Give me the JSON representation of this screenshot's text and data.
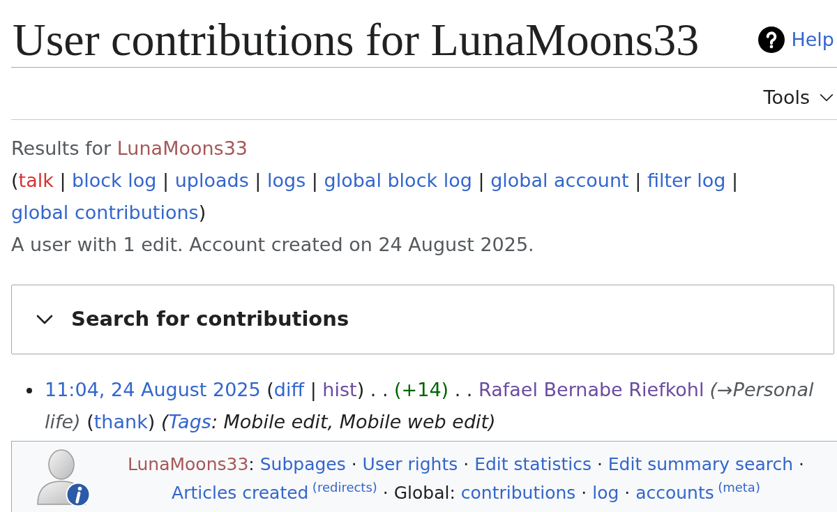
{
  "header": {
    "title": "User contributions for LunaMoons33",
    "help": "Help"
  },
  "tools": {
    "label": "Tools"
  },
  "results": [
    {
      "kind": "plain",
      "text": "Results for "
    },
    {
      "kind": "new-visited",
      "text": "LunaMoons33"
    }
  ],
  "user_links": [
    {
      "kind": "plain",
      "text": "("
    },
    {
      "kind": "new",
      "text": "talk"
    },
    {
      "kind": "plain",
      "text": " | "
    },
    {
      "kind": "link",
      "text": "block log"
    },
    {
      "kind": "plain",
      "text": " | "
    },
    {
      "kind": "link",
      "text": "uploads"
    },
    {
      "kind": "plain",
      "text": " | "
    },
    {
      "kind": "link",
      "text": "logs"
    },
    {
      "kind": "plain",
      "text": " | "
    },
    {
      "kind": "link",
      "text": "global block log"
    },
    {
      "kind": "plain",
      "text": " | "
    },
    {
      "kind": "link",
      "text": "global account"
    },
    {
      "kind": "plain",
      "text": " | "
    },
    {
      "kind": "link",
      "text": "filter log"
    },
    {
      "kind": "plain",
      "text": " | "
    },
    {
      "kind": "link",
      "text": "global contributions"
    },
    {
      "kind": "plain",
      "text": ")"
    }
  ],
  "summary": "A user with 1 edit. Account created on 24 August 2025.",
  "search_panel": {
    "title": "Search for contributions",
    "expanded": false
  },
  "contributions": [
    {
      "segments": [
        {
          "kind": "link",
          "text": "11:04, 24 August 2025"
        },
        {
          "kind": "plain",
          "text": " ("
        },
        {
          "kind": "link",
          "text": "diff"
        },
        {
          "kind": "plain",
          "text": " | "
        },
        {
          "kind": "visited",
          "text": "hist"
        },
        {
          "kind": "plain",
          "text": ") . . "
        },
        {
          "kind": "added",
          "text": "(+14)"
        },
        {
          "kind": "plain",
          "text": " . . "
        },
        {
          "kind": "visited",
          "text": "Rafael Bernabe Riefkohl"
        },
        {
          "kind": "comment",
          "text": "(→Personal life)"
        },
        {
          "kind": "plain",
          "text": " ("
        },
        {
          "kind": "link",
          "text": "thank"
        },
        {
          "kind": "plain",
          "text": ") "
        },
        {
          "kind": "tag-plain",
          "text": "("
        },
        {
          "kind": "tag-link",
          "text": "Tags"
        },
        {
          "kind": "tag-plain",
          "text": ": Mobile edit, Mobile web edit)"
        }
      ]
    }
  ],
  "user_box": {
    "segments": [
      {
        "kind": "new-visited",
        "text": "LunaMoons33"
      },
      {
        "kind": "plain",
        "text": ": "
      },
      {
        "kind": "link",
        "text": "Subpages"
      },
      {
        "kind": "plain",
        "text": " · "
      },
      {
        "kind": "link",
        "text": "User rights"
      },
      {
        "kind": "plain",
        "text": " · "
      },
      {
        "kind": "link",
        "text": "Edit statistics"
      },
      {
        "kind": "plain",
        "text": " · "
      },
      {
        "kind": "link",
        "text": "Edit summary search"
      },
      {
        "kind": "plain",
        "text": " · "
      },
      {
        "kind": "link",
        "text": "Articles created"
      },
      {
        "kind": "sup-link",
        "text": "(redirects)"
      },
      {
        "kind": "plain",
        "text": " · Global: "
      },
      {
        "kind": "link",
        "text": "contributions"
      },
      {
        "kind": "plain",
        "text": " · "
      },
      {
        "kind": "link",
        "text": "log"
      },
      {
        "kind": "plain",
        "text": " · "
      },
      {
        "kind": "link",
        "text": "accounts"
      },
      {
        "kind": "sup-link",
        "text": "(meta)"
      }
    ]
  }
}
